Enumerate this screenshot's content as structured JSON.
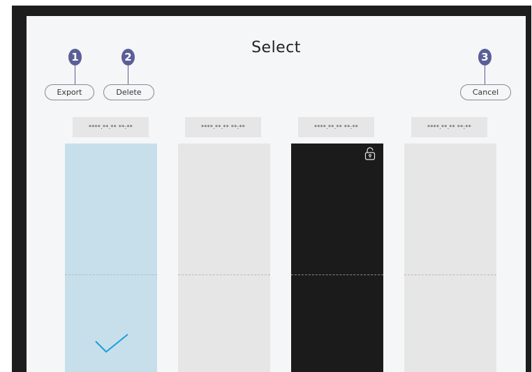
{
  "header": {
    "title": "Select"
  },
  "toolbar": {
    "export_label": "Export",
    "delete_label": "Delete",
    "cancel_label": "Cancel"
  },
  "callouts": [
    "1",
    "2",
    "3"
  ],
  "items": [
    {
      "date": "****.**.** **:**",
      "selected": true,
      "locked": false,
      "color": "#c6dfeb"
    },
    {
      "date": "****.**.** **:**",
      "selected": false,
      "locked": false,
      "color": "#e6e6e6"
    },
    {
      "date": "****.**.** **:**",
      "selected": false,
      "locked": true,
      "color": "#1b1b1b"
    },
    {
      "date": "****.**.** **:**",
      "selected": false,
      "locked": false,
      "color": "#e6e6e6"
    }
  ],
  "icons": {
    "selected": "checkmark-icon",
    "locked": "unlock-icon"
  },
  "colors": {
    "accent": "#1a9fd9",
    "callout": "#5a5f97"
  }
}
